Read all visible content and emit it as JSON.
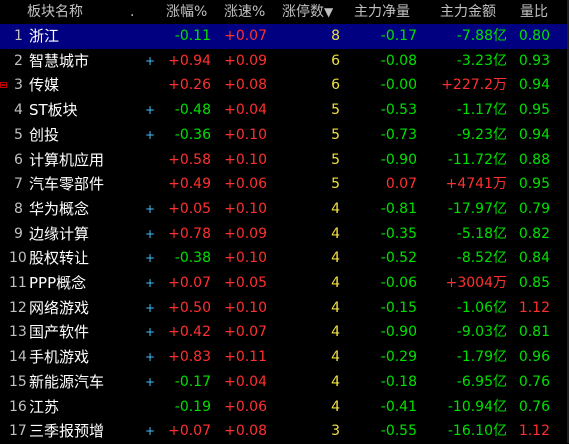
{
  "header": {
    "name": "板块名称",
    "dot": ".",
    "change_pct": "涨幅%",
    "speed_pct": "涨速%",
    "limit_up_count": "涨停数",
    "main_net": "主力净量",
    "main_amount": "主力金额",
    "vol_ratio": "量比",
    "sort_icon": "down-arrow-icon"
  },
  "colors": {
    "up": "#ff3030",
    "down": "#00e000",
    "count": "#f0e040",
    "selected_bg": "#000080"
  },
  "rows": [
    {
      "num": "1",
      "name": "浙江",
      "plus": "",
      "change": "-0.11",
      "speed": "+0.07",
      "count": "8",
      "net": "-0.17",
      "amount": "-7.88亿",
      "ratio": "0.80"
    },
    {
      "num": "2",
      "name": "智慧城市",
      "plus": "+",
      "change": "+0.94",
      "speed": "+0.09",
      "count": "6",
      "net": "-0.08",
      "amount": "-3.23亿",
      "ratio": "0.93"
    },
    {
      "num": "3",
      "name": "传媒",
      "plus": "",
      "change": "+0.26",
      "speed": "+0.08",
      "count": "6",
      "net": "-0.00",
      "amount": "+227.2万",
      "ratio": "0.94"
    },
    {
      "num": "4",
      "name": "ST板块",
      "plus": "+",
      "change": "-0.48",
      "speed": "+0.04",
      "count": "5",
      "net": "-0.53",
      "amount": "-1.17亿",
      "ratio": "0.95"
    },
    {
      "num": "5",
      "name": "创投",
      "plus": "+",
      "change": "-0.36",
      "speed": "+0.10",
      "count": "5",
      "net": "-0.73",
      "amount": "-9.23亿",
      "ratio": "0.94"
    },
    {
      "num": "6",
      "name": "计算机应用",
      "plus": "",
      "change": "+0.58",
      "speed": "+0.10",
      "count": "5",
      "net": "-0.90",
      "amount": "-11.72亿",
      "ratio": "0.88"
    },
    {
      "num": "7",
      "name": "汽车零部件",
      "plus": "",
      "change": "+0.49",
      "speed": "+0.06",
      "count": "5",
      "net": "0.07",
      "amount": "+4741万",
      "ratio": "0.95"
    },
    {
      "num": "8",
      "name": "华为概念",
      "plus": "+",
      "change": "+0.05",
      "speed": "+0.10",
      "count": "4",
      "net": "-0.81",
      "amount": "-17.97亿",
      "ratio": "0.79"
    },
    {
      "num": "9",
      "name": "边缘计算",
      "plus": "+",
      "change": "+0.78",
      "speed": "+0.09",
      "count": "4",
      "net": "-0.35",
      "amount": "-5.18亿",
      "ratio": "0.82"
    },
    {
      "num": "10",
      "name": "股权转让",
      "plus": "+",
      "change": "-0.38",
      "speed": "+0.10",
      "count": "4",
      "net": "-0.52",
      "amount": "-8.52亿",
      "ratio": "0.84"
    },
    {
      "num": "11",
      "name": "PPP概念",
      "plus": "+",
      "change": "+0.07",
      "speed": "+0.05",
      "count": "4",
      "net": "-0.06",
      "amount": "+3004万",
      "ratio": "0.85"
    },
    {
      "num": "12",
      "name": "网络游戏",
      "plus": "+",
      "change": "+0.50",
      "speed": "+0.10",
      "count": "4",
      "net": "-0.15",
      "amount": "-1.06亿",
      "ratio": "1.12"
    },
    {
      "num": "13",
      "name": "国产软件",
      "plus": "+",
      "change": "+0.42",
      "speed": "+0.07",
      "count": "4",
      "net": "-0.90",
      "amount": "-9.03亿",
      "ratio": "0.81"
    },
    {
      "num": "14",
      "name": "手机游戏",
      "plus": "+",
      "change": "+0.83",
      "speed": "+0.11",
      "count": "4",
      "net": "-0.29",
      "amount": "-1.79亿",
      "ratio": "0.96"
    },
    {
      "num": "15",
      "name": "新能源汽车",
      "plus": "+",
      "change": "-0.17",
      "speed": "+0.04",
      "count": "4",
      "net": "-0.18",
      "amount": "-6.95亿",
      "ratio": "0.76"
    },
    {
      "num": "16",
      "name": "江苏",
      "plus": "",
      "change": "-0.19",
      "speed": "+0.06",
      "count": "4",
      "net": "-0.41",
      "amount": "-10.94亿",
      "ratio": "0.76"
    },
    {
      "num": "17",
      "name": "三季报预增",
      "plus": "+",
      "change": "+0.07",
      "speed": "+0.08",
      "count": "3",
      "net": "-0.55",
      "amount": "-16.10亿",
      "ratio": "1.12"
    }
  ]
}
